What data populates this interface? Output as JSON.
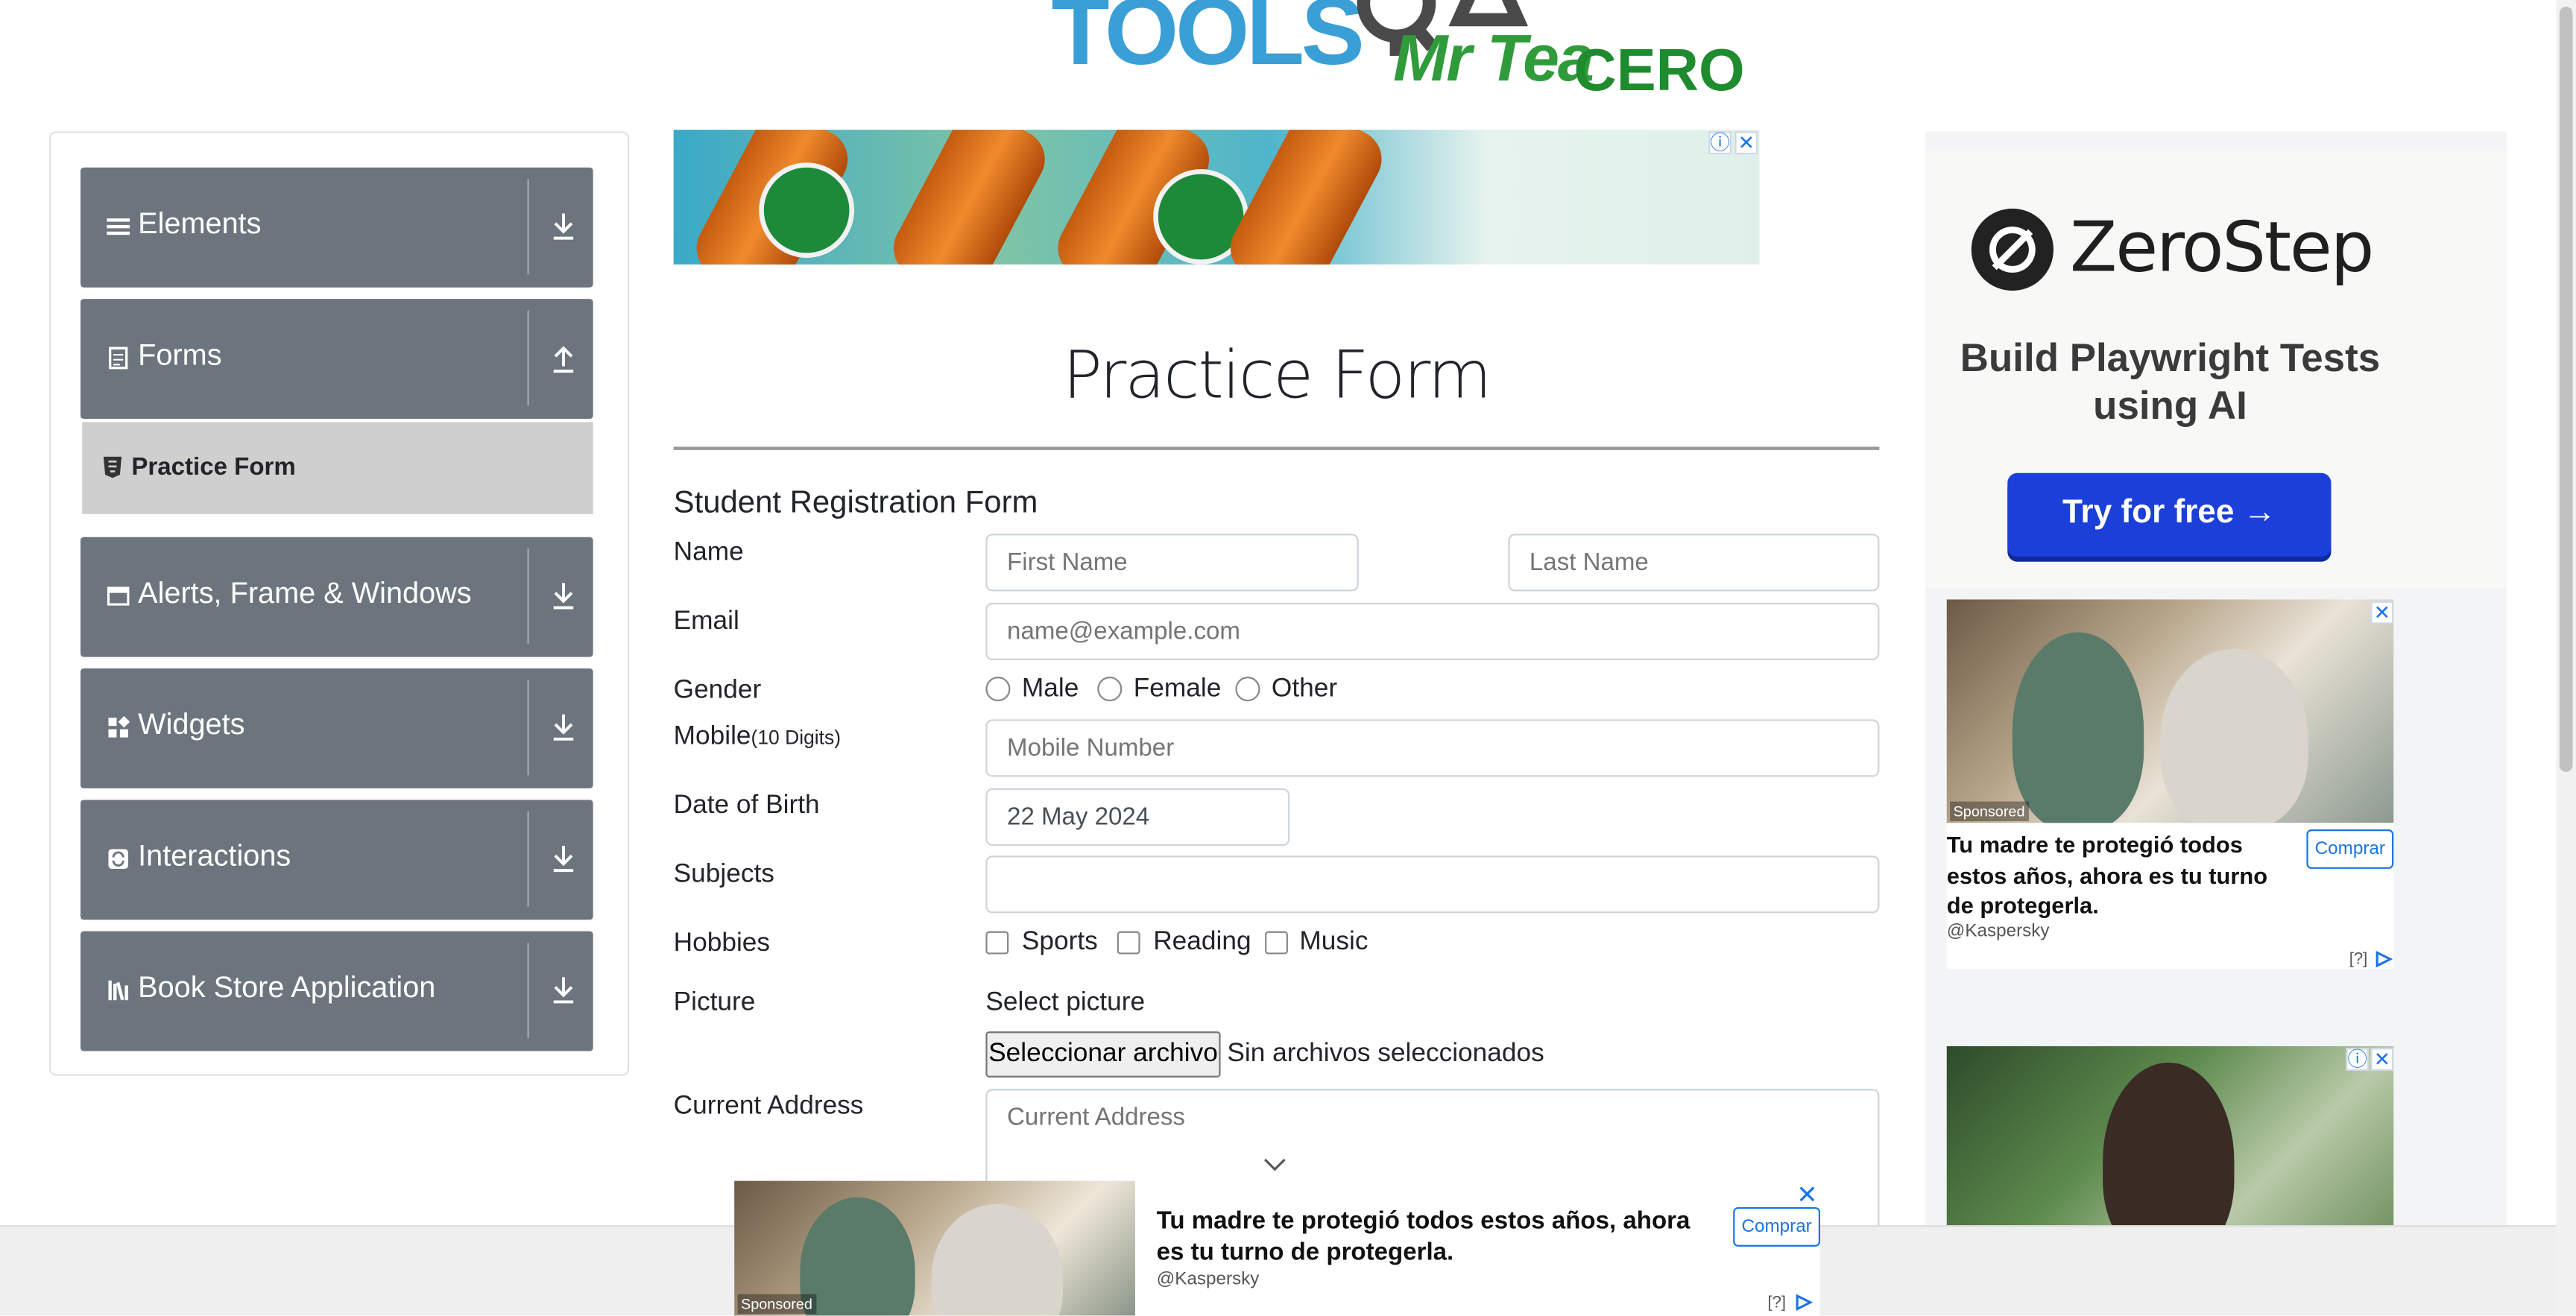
{
  "logo": {
    "text": "TOOLS",
    "suffix": "QA"
  },
  "sidebar": {
    "groups": [
      {
        "label": "Elements",
        "icon": "menu-icon",
        "arrow": "download-arrow-icon"
      },
      {
        "label": "Forms",
        "icon": "document-icon",
        "arrow": "upload-arrow-icon"
      },
      {
        "label": "Alerts, Frame & Windows",
        "icon": "window-icon",
        "arrow": "download-arrow-icon"
      },
      {
        "label": "Widgets",
        "icon": "widgets-icon",
        "arrow": "download-arrow-icon"
      },
      {
        "label": "Interactions",
        "icon": "interactions-icon",
        "arrow": "download-arrow-icon"
      },
      {
        "label": "Book Store Application",
        "icon": "library-icon",
        "arrow": "download-arrow-icon"
      }
    ],
    "subitem": {
      "label": "Practice Form",
      "icon": "html5-icon"
    }
  },
  "top_ad": {
    "brand": "Mr Tea",
    "brand_suffix": "CERO"
  },
  "form": {
    "title": "Practice Form",
    "subtitle": "Student Registration Form",
    "labels": {
      "name": "Name",
      "email": "Email",
      "gender": "Gender",
      "mobile": "Mobile",
      "mobile_hint": "(10 Digits)",
      "dob": "Date of Birth",
      "subjects": "Subjects",
      "hobbies": "Hobbies",
      "picture": "Picture",
      "address": "Current Address"
    },
    "placeholders": {
      "first_name": "First Name",
      "last_name": "Last Name",
      "email": "name@example.com",
      "mobile": "Mobile Number",
      "address": "Current Address"
    },
    "dob_value": "22 May 2024",
    "genders": [
      "Male",
      "Female",
      "Other"
    ],
    "hobbies": [
      "Sports",
      "Reading",
      "Music"
    ],
    "picture_caption": "Select picture",
    "file_button": "Seleccionar archivo",
    "file_status": "Sin archivos seleccionados"
  },
  "right_ad": {
    "brand": "ZeroStep",
    "tagline": "Build Playwright Tests using AI",
    "cta": "Try for free →",
    "sponsored": "Sponsored",
    "headline": "Tu madre te protegió todos estos años, ahora es tu turno de protegerla.",
    "buy": "Comprar",
    "source": "@Kaspersky",
    "info": "[?]"
  },
  "bottom_ad": {
    "sponsored": "Sponsored",
    "headline": "Tu madre te protegió todos estos años, ahora es tu turno de protegerla.",
    "buy": "Comprar",
    "source": "@Kaspersky",
    "info": "[?]"
  },
  "colors": {
    "sidebar_group": "#6c757d",
    "subitem_active": "#cfcfcf",
    "cta_blue": "#1b3fd8",
    "logo_blue": "#3a9fd6"
  }
}
